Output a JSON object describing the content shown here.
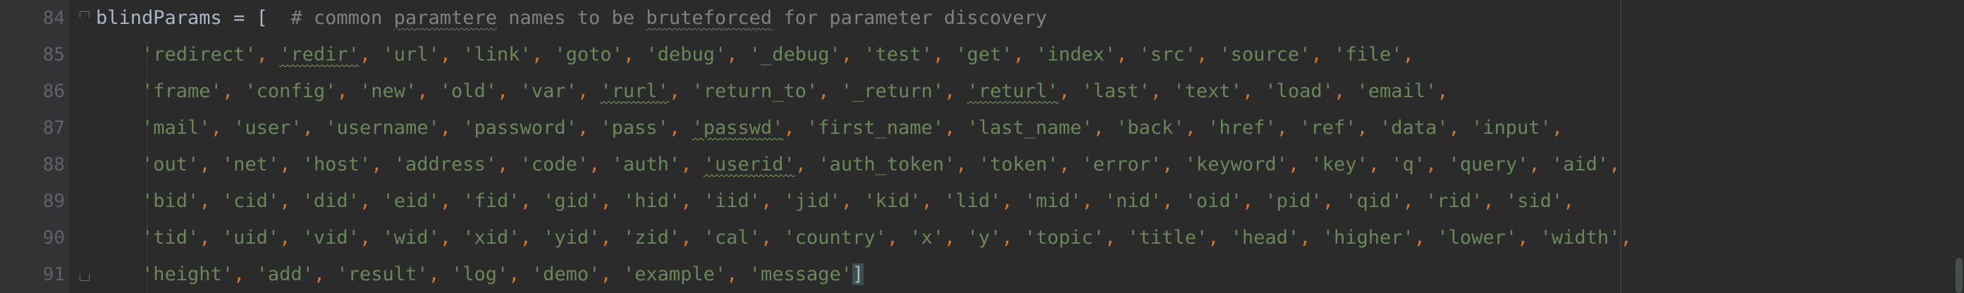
{
  "editor": {
    "colors": {
      "background": "#2b2b2b",
      "gutter": "#313335",
      "line_number": "#606366",
      "identifier": "#a9b7c6",
      "comment": "#808080",
      "string": "#6a8759",
      "comma": "#cc7832"
    },
    "lines": [
      {
        "number": "84",
        "fold": "start",
        "head": "blindParams = [",
        "comment_parts": [
          "# common ",
          "paramtere",
          " names to be ",
          "bruteforced",
          " for parameter discovery"
        ],
        "strings": []
      },
      {
        "number": "85",
        "fold": "",
        "strings": [
          "'redirect'",
          "'redir'",
          "'url'",
          "'link'",
          "'goto'",
          "'debug'",
          "'_debug'",
          "'test'",
          "'get'",
          "'index'",
          "'src'",
          "'source'",
          "'file'"
        ]
      },
      {
        "number": "86",
        "fold": "",
        "strings": [
          "'frame'",
          "'config'",
          "'new'",
          "'old'",
          "'var'",
          "'rurl'",
          "'return_to'",
          "'_return'",
          "'returl'",
          "'last'",
          "'text'",
          "'load'",
          "'email'"
        ]
      },
      {
        "number": "87",
        "fold": "",
        "strings": [
          "'mail'",
          "'user'",
          "'username'",
          "'password'",
          "'pass'",
          "'passwd'",
          "'first_name'",
          "'last_name'",
          "'back'",
          "'href'",
          "'ref'",
          "'data'",
          "'input'"
        ]
      },
      {
        "number": "88",
        "fold": "",
        "strings": [
          "'out'",
          "'net'",
          "'host'",
          "'address'",
          "'code'",
          "'auth'",
          "'userid'",
          "'auth_token'",
          "'token'",
          "'error'",
          "'keyword'",
          "'key'",
          "'q'",
          "'query'",
          "'aid'"
        ]
      },
      {
        "number": "89",
        "fold": "",
        "strings": [
          "'bid'",
          "'cid'",
          "'did'",
          "'eid'",
          "'fid'",
          "'gid'",
          "'hid'",
          "'iid'",
          "'jid'",
          "'kid'",
          "'lid'",
          "'mid'",
          "'nid'",
          "'oid'",
          "'pid'",
          "'qid'",
          "'rid'",
          "'sid'"
        ]
      },
      {
        "number": "90",
        "fold": "",
        "strings": [
          "'tid'",
          "'uid'",
          "'vid'",
          "'wid'",
          "'xid'",
          "'yid'",
          "'zid'",
          "'cal'",
          "'country'",
          "'x'",
          "'y'",
          "'topic'",
          "'title'",
          "'head'",
          "'higher'",
          "'lower'",
          "'width'"
        ]
      },
      {
        "number": "91",
        "fold": "end",
        "strings": [
          "'height'",
          "'add'",
          "'result'",
          "'log'",
          "'demo'",
          "'example'",
          "'message'"
        ],
        "closing": "]"
      }
    ],
    "misspelled": [
      "redir",
      "rurl",
      "returl",
      "passwd",
      "userid",
      "paramtere",
      "bruteforced"
    ]
  }
}
